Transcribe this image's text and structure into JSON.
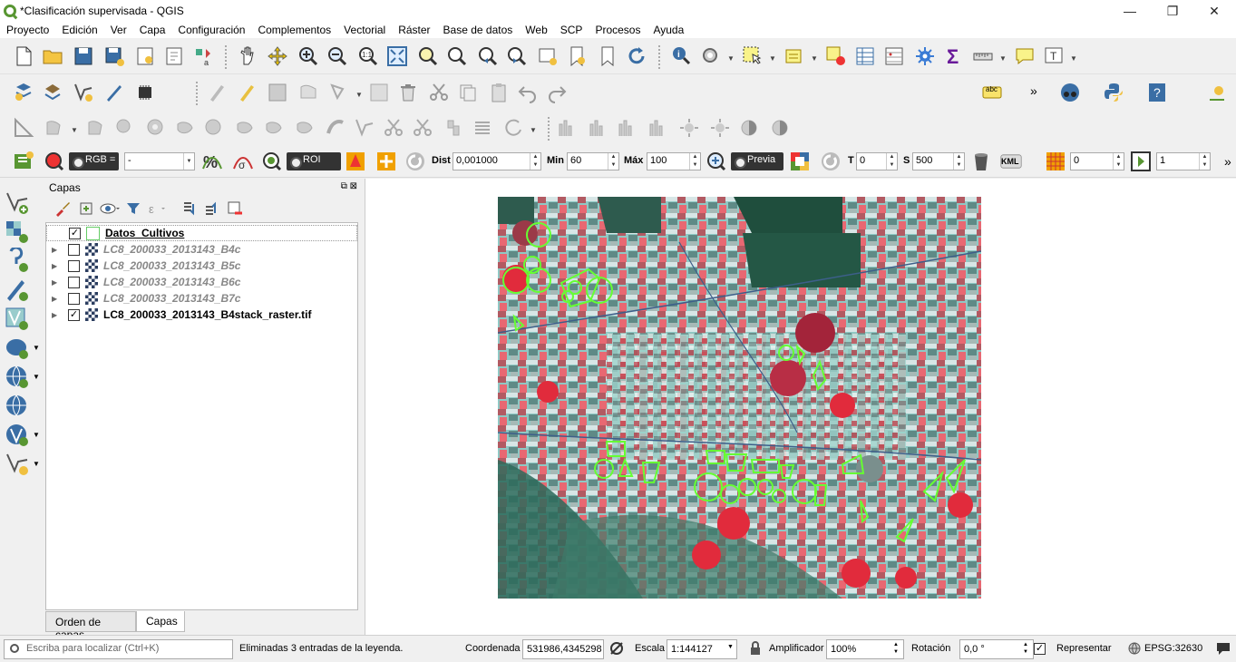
{
  "window": {
    "title": "*Clasificación supervisada - QGIS",
    "controls": [
      "—",
      "❐",
      "✕"
    ]
  },
  "menu": [
    "Proyecto",
    "Edición",
    "Ver",
    "Capa",
    "Configuración",
    "Complementos",
    "Vectorial",
    "Ráster",
    "Base de datos",
    "Web",
    "SCP",
    "Procesos",
    "Ayuda"
  ],
  "scp_toolbar": {
    "rgb_label": "RGB =",
    "rgb_value": "-",
    "roi_label": "ROI",
    "dist_label": "Dist",
    "dist_value": "0,001000",
    "min_label": "Min",
    "min_value": "60",
    "max_label": "Máx",
    "max_value": "100",
    "preview_label": "Previa",
    "t_label": "T",
    "t_value": "0",
    "s_label": "S",
    "s_value": "500",
    "kml_label": "KML",
    "band_value": "0",
    "class_value": "1",
    "overflow": "»"
  },
  "toolbar2": {
    "abc_label": "abc",
    "overflow": "»"
  },
  "layers_panel": {
    "title": "Capas",
    "layers": [
      {
        "name": "Datos_Cultivos",
        "checked": true,
        "type": "vector",
        "expander": ""
      },
      {
        "name": "LC8_200033_2013143_B4c",
        "checked": false,
        "type": "raster",
        "expander": "▶"
      },
      {
        "name": "LC8_200033_2013143_B5c",
        "checked": false,
        "type": "raster",
        "expander": "▶"
      },
      {
        "name": "LC8_200033_2013143_B6c",
        "checked": false,
        "type": "raster",
        "expander": "▶"
      },
      {
        "name": "LC8_200033_2013143_B7c",
        "checked": false,
        "type": "raster",
        "expander": "▶"
      },
      {
        "name": "LC8_200033_2013143_B4stack_raster.tif",
        "checked": true,
        "type": "raster",
        "expander": "▶"
      }
    ],
    "tabs": [
      "Orden de capas",
      "Capas"
    ],
    "active_tab": "Capas"
  },
  "status": {
    "search_placeholder": "Escriba para localizar (Ctrl+K)",
    "message": "Eliminadas 3 entradas de la leyenda.",
    "coord_label": "Coordenada",
    "coord_value": "531986,4345298",
    "scale_label": "Escala",
    "scale_value": "1:144127",
    "magnifier_label": "Amplificador",
    "magnifier_value": "100%",
    "rotation_label": "Rotación",
    "rotation_value": "0,0 °",
    "render_label": "Representar",
    "render_checked": true,
    "crs": "EPSG:32630"
  },
  "colors": {
    "accent_green": "#589632",
    "roi_green": "#66ff33",
    "map_red": "#e8283c",
    "map_cyan": "#8fd6d0"
  }
}
